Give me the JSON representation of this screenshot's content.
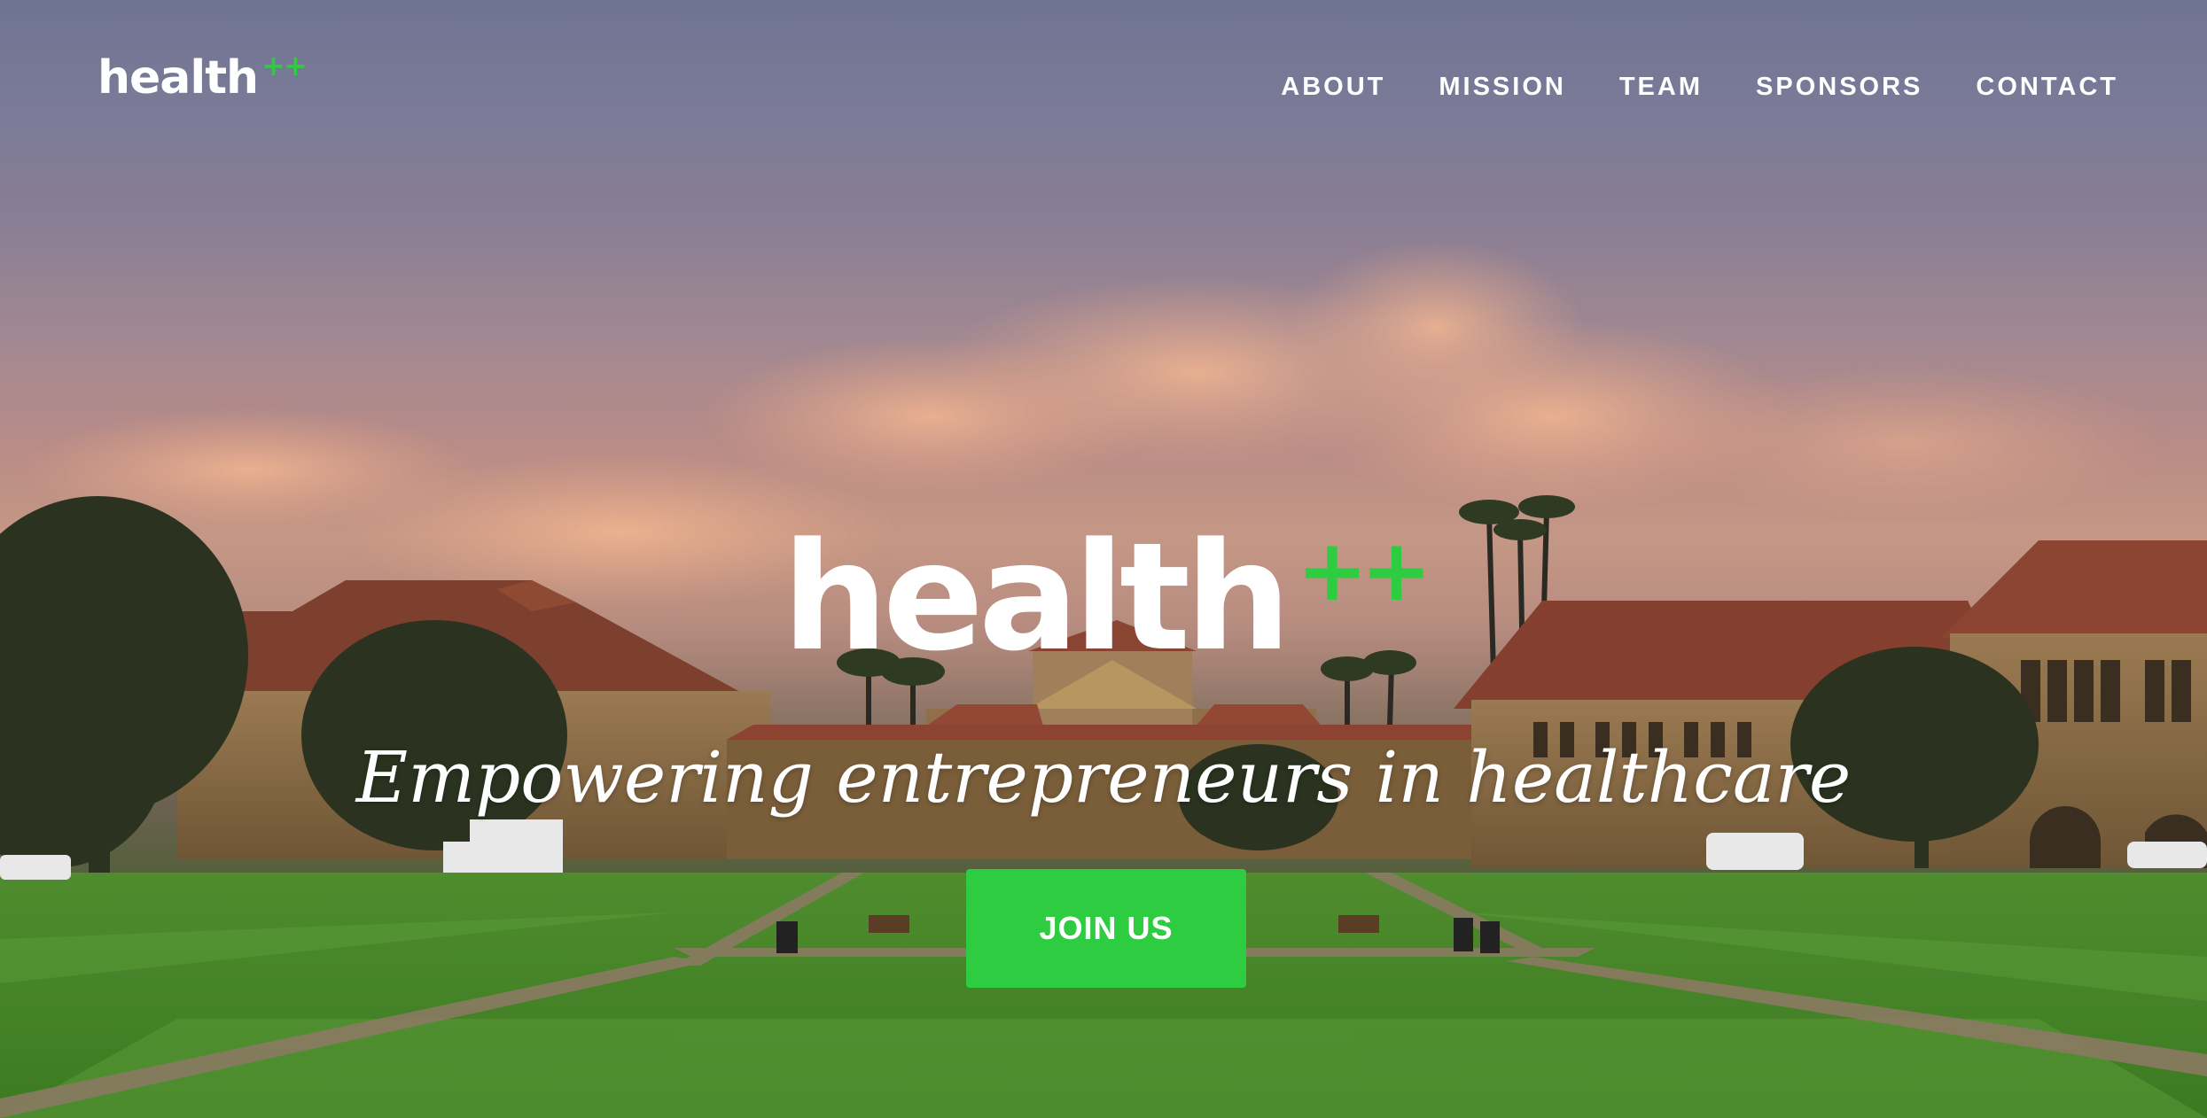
{
  "brand": {
    "logo_text": "health",
    "logo_plus": "++",
    "accent_color": "#2ecc40"
  },
  "nav": {
    "items": [
      {
        "label": "ABOUT"
      },
      {
        "label": "MISSION"
      },
      {
        "label": "TEAM"
      },
      {
        "label": "SPONSORS"
      },
      {
        "label": "CONTACT"
      }
    ]
  },
  "hero": {
    "title": "health",
    "title_plus": "++",
    "tagline": "Empowering entrepreneurs in healthcare",
    "cta_label": "JOIN US",
    "background": "campus-quad-sunset-photo"
  }
}
